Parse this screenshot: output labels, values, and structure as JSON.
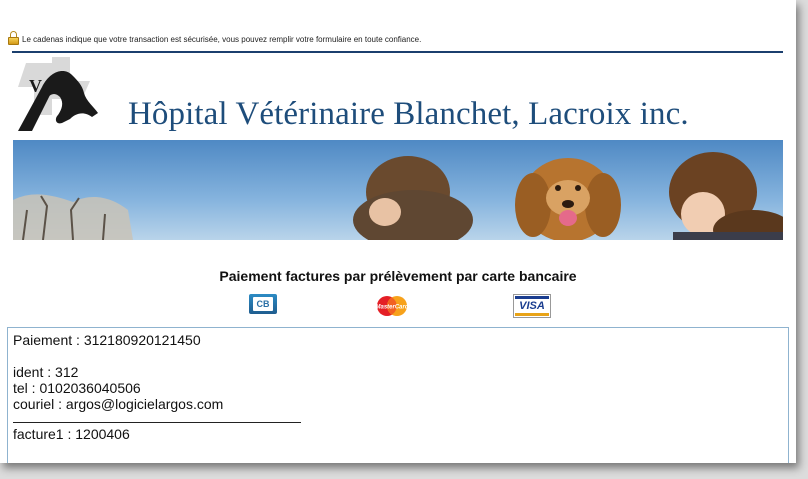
{
  "security_notice": "Le cadenas indique que votre transaction est sécurisée, vous pouvez remplir votre formulaire en toute confiance.",
  "clinic": {
    "logo_letter": "V",
    "name": "Hôpital Vétérinaire Blanchet, Lacroix inc."
  },
  "payment": {
    "heading": "Paiement factures par prélèvement par carte bancaire",
    "cards": [
      {
        "name": "cb-card-icon",
        "label": "CB"
      },
      {
        "name": "mastercard-icon",
        "label": "MasterCard"
      },
      {
        "name": "visa-icon",
        "label": "VISA"
      }
    ]
  },
  "details": {
    "payment_line": "Paiement : 312180920121450",
    "ident": "ident : 312",
    "tel": "tel : 0102036040506",
    "email": "couriel : argos@logicielargos.com",
    "invoice1": "facture1 : 1200406"
  },
  "colors": {
    "title": "#1e4d7b",
    "rule": "#1b3f6e",
    "box_border": "#8fb3cf"
  }
}
